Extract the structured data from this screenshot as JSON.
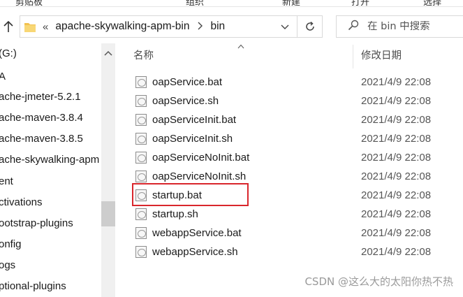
{
  "ribbon": {
    "labels": [
      "剪贴板",
      "组织",
      "新建",
      "打开",
      "选择"
    ]
  },
  "address": {
    "sep": "«",
    "crumbs": [
      "apache-skywalking-apm-bin",
      "bin"
    ]
  },
  "search": {
    "placeholder": "在 bin 中搜索"
  },
  "nav": {
    "items": [
      "(G:)",
      "A",
      "ache-jmeter-5.2.1",
      "ache-maven-3.8.4",
      "ache-maven-3.8.5",
      "ache-skywalking-apm",
      "ent",
      "ctivations",
      "ootstrap-plugins",
      "onfig",
      "ogs",
      "ptional-plugins"
    ]
  },
  "columns": {
    "name": "名称",
    "modified": "修改日期"
  },
  "files": [
    {
      "name": "oapService.bat",
      "date": "2021/4/9 22:08"
    },
    {
      "name": "oapService.sh",
      "date": "2021/4/9 22:08"
    },
    {
      "name": "oapServiceInit.bat",
      "date": "2021/4/9 22:08"
    },
    {
      "name": "oapServiceInit.sh",
      "date": "2021/4/9 22:08"
    },
    {
      "name": "oapServiceNoInit.bat",
      "date": "2021/4/9 22:08"
    },
    {
      "name": "oapServiceNoInit.sh",
      "date": "2021/4/9 22:08"
    },
    {
      "name": "startup.bat",
      "date": "2021/4/9 22:08"
    },
    {
      "name": "startup.sh",
      "date": "2021/4/9 22:08"
    },
    {
      "name": "webappService.bat",
      "date": "2021/4/9 22:08"
    },
    {
      "name": "webappService.sh",
      "date": "2021/4/9 22:08"
    }
  ],
  "highlight_color": "#d9262c",
  "watermark": "CSDN @这么大的太阳你热不热"
}
